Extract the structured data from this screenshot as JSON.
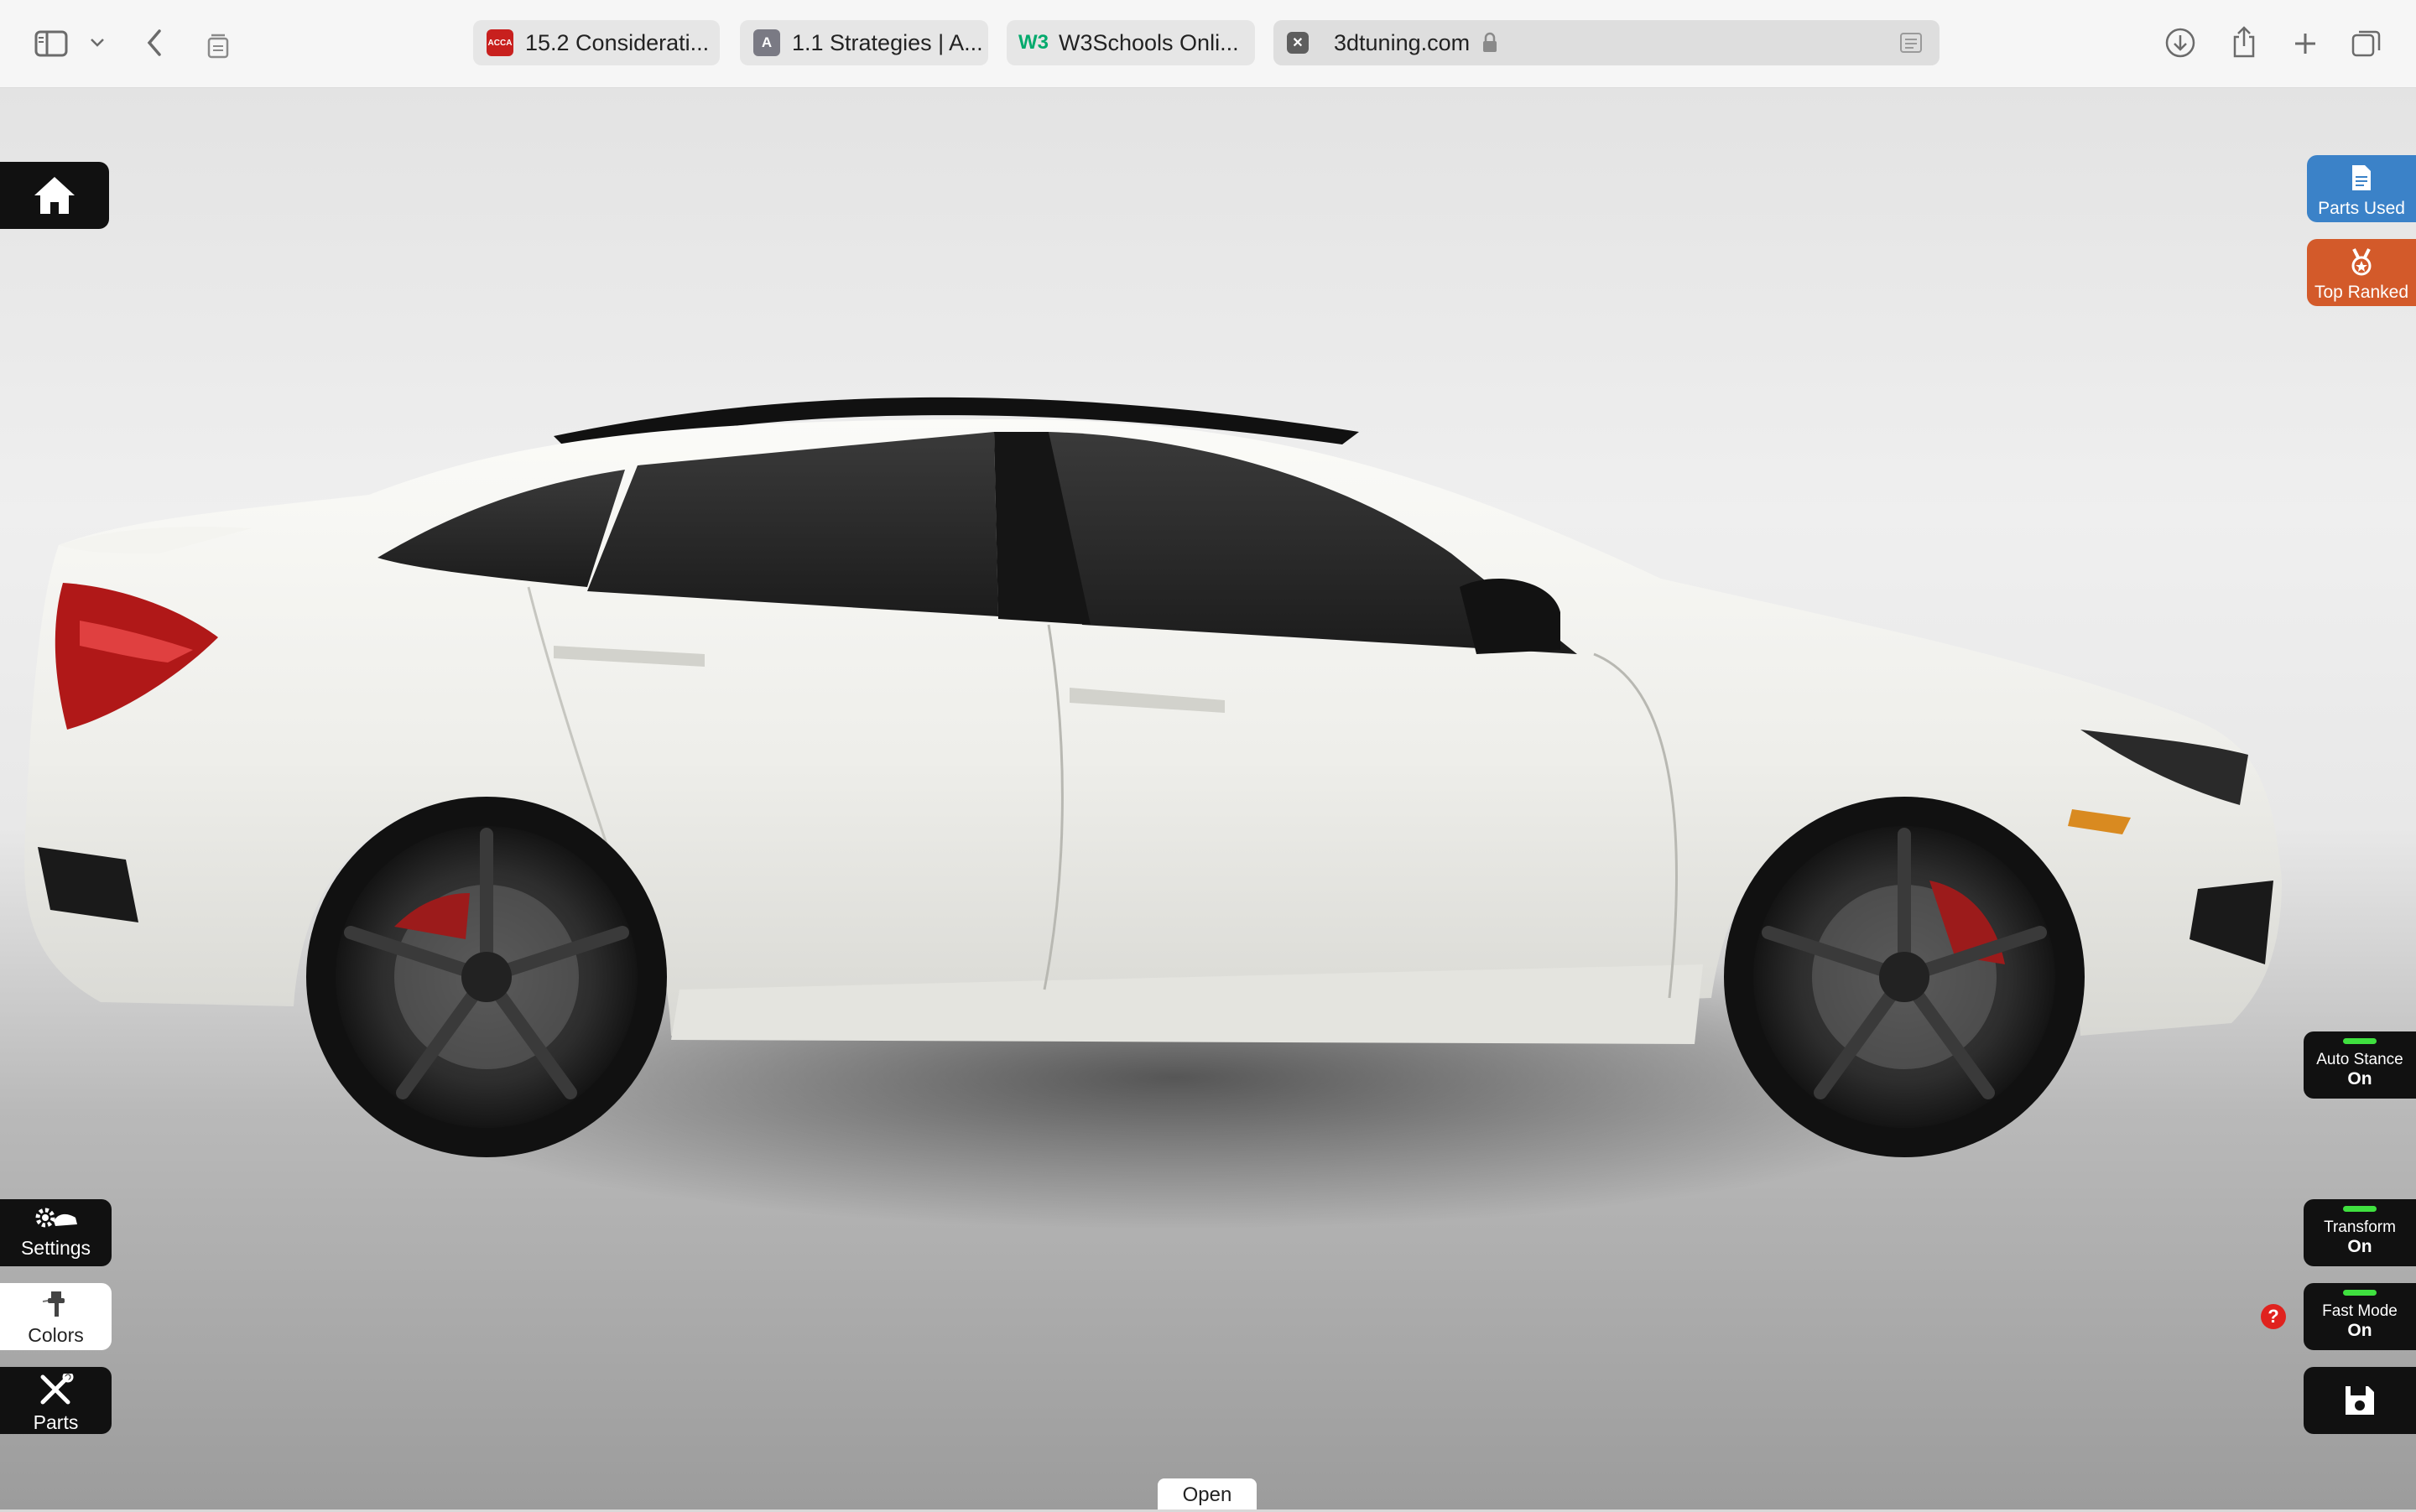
{
  "browser": {
    "tabs": [
      {
        "label": "15.2 Considerati...",
        "favicon_text": "ACCA",
        "favicon_color": "#c8201e"
      },
      {
        "label": "1.1 Strategies | A...",
        "favicon_text": "A",
        "favicon_color": "#7a7a84"
      },
      {
        "label": "W3Schools Onli...",
        "favicon_text": "W3",
        "favicon_color": "#04aa6d"
      }
    ],
    "active_tab": {
      "label": "3dtuning.com",
      "favicon_text": "✕"
    },
    "icons": {
      "sidebar": "sidebar-icon",
      "back": "chevron-left-icon",
      "tab_overview": "tab-overview-icon",
      "download": "download-icon",
      "share": "share-icon",
      "new_tab": "plus-icon",
      "tabs": "tabs-icon"
    }
  },
  "left_dock": {
    "settings": "Settings",
    "colors": "Colors",
    "parts": "Parts"
  },
  "right_dock": {
    "parts_used": "Parts Used",
    "top_ranked": "Top Ranked",
    "auto_stance": {
      "label": "Auto Stance",
      "state": "On"
    },
    "transform": {
      "label": "Transform",
      "state": "On"
    },
    "fast_mode": {
      "label": "Fast Mode",
      "state": "On"
    },
    "help": "?"
  },
  "bottom": {
    "open": "Open"
  },
  "colors": {
    "parts_used": "#3b82c8",
    "top_ranked": "#d35a2a",
    "led_on": "#3fe03f",
    "help": "#e0221e"
  }
}
